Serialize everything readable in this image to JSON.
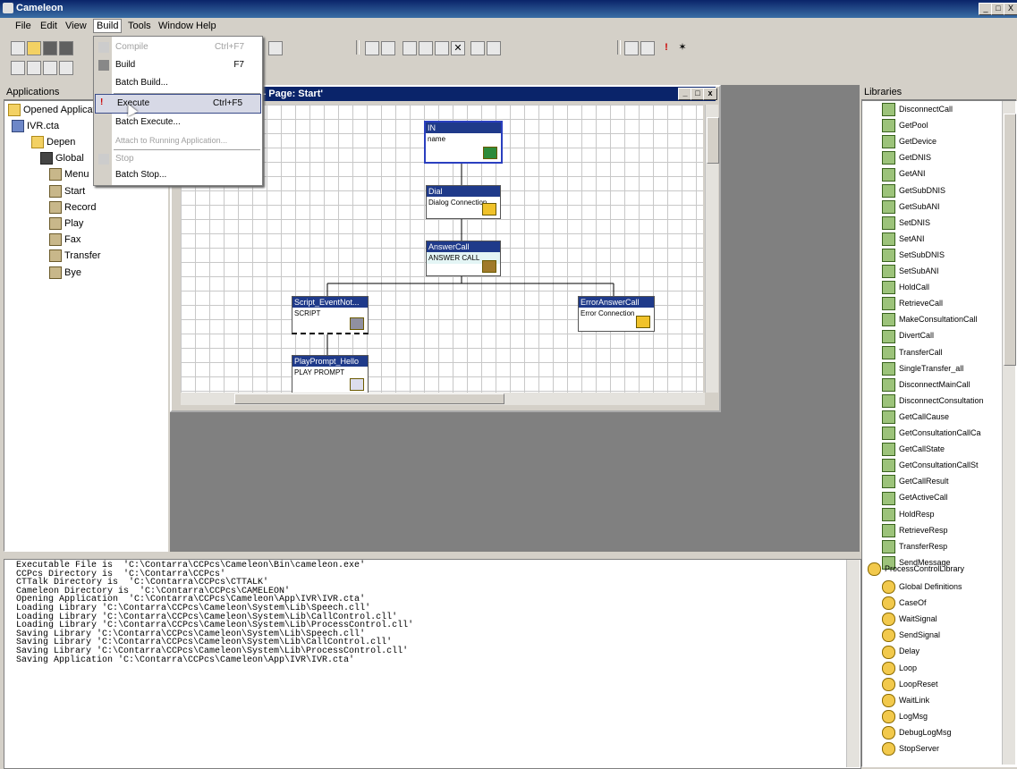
{
  "window": {
    "title": "Cameleon",
    "controls": [
      "_",
      "□",
      "X"
    ]
  },
  "menu": [
    "File",
    "Edit",
    "View",
    "Build",
    "Tools",
    "Window",
    "Help"
  ],
  "build_menu": {
    "items": [
      {
        "label": "Compile",
        "shortcut": "Ctrl+F7",
        "disabled": true
      },
      {
        "label": "Build",
        "shortcut": "F7",
        "disabled": false
      },
      {
        "label": "Batch Build...",
        "shortcut": "",
        "disabled": false
      },
      {
        "label": "Execute",
        "shortcut": "Ctrl+F5",
        "disabled": false,
        "selected": true
      },
      {
        "label": "Batch Execute...",
        "shortcut": "",
        "disabled": false
      },
      {
        "label": "Attach to Running Application...",
        "shortcut": "",
        "disabled": true
      },
      {
        "label": "Stop",
        "shortcut": "",
        "disabled": true
      },
      {
        "label": "Batch Stop...",
        "shortcut": "",
        "disabled": false
      }
    ]
  },
  "applications_panel": {
    "title": "Applications",
    "root": "Opened Applications",
    "app": "IVR.cta",
    "children": [
      "Depen",
      "Global",
      "Menu",
      "Start",
      "Record",
      "Play",
      "Fax",
      "Transfer",
      "Bye"
    ]
  },
  "editor": {
    "title": "cta' - Page: Start'",
    "nodes": [
      {
        "title": "IN",
        "body": "name"
      },
      {
        "title": "Dial",
        "body": "Dialog Connection"
      },
      {
        "title": "AnswerCall",
        "body": "ANSWER CALL"
      },
      {
        "title": "Script_EventNot...",
        "body": "SCRIPT"
      },
      {
        "title": "ErrorAnswerCall",
        "body": "Error Connection"
      },
      {
        "title": "PlayPrompt_Hello",
        "body": "PLAY PROMPT"
      }
    ]
  },
  "output_lines": [
    "Executable File is  'C:\\Contarra\\CCPcs\\Cameleon\\Bin\\cameleon.exe'",
    "CCPcs Directory is  'C:\\Contarra\\CCPcs'",
    "CTTalk Directory is  'C:\\Contarra\\CCPcs\\CTTALK'",
    "Cameleon Directory is  'C:\\Contarra\\CCPcs\\CAMELEON'",
    "Opening Application  'C:\\Contarra\\CCPcs\\Cameleon\\App\\IVR\\IVR.cta'",
    "Loading Library 'C:\\Contarra\\CCPcs\\Cameleon\\System\\Lib\\Speech.cll'",
    "Loading Library 'C:\\Contarra\\CCPcs\\Cameleon\\System\\Lib\\CallControl.cll'",
    "Loading Library 'C:\\Contarra\\CCPcs\\Cameleon\\System\\Lib\\ProcessControl.cll'",
    "Saving Library 'C:\\Contarra\\CCPcs\\Cameleon\\System\\Lib\\Speech.cll'",
    "Saving Library 'C:\\Contarra\\CCPcs\\Cameleon\\System\\Lib\\CallControl.cll'",
    "Saving Library 'C:\\Contarra\\CCPcs\\Cameleon\\System\\Lib\\ProcessControl.cll'",
    "Saving Application 'C:\\Contarra\\CCPcs\\Cameleon\\App\\IVR\\IVR.cta'"
  ],
  "libraries_panel": {
    "title": "Libraries",
    "call_items": [
      "DisconnectCall",
      "GetPool",
      "GetDevice",
      "GetDNIS",
      "GetANI",
      "GetSubDNIS",
      "GetSubANI",
      "SetDNIS",
      "SetANI",
      "SetSubDNIS",
      "SetSubANI",
      "HoldCall",
      "RetrieveCall",
      "MakeConsultationCall",
      "DivertCall",
      "TransferCall",
      "SingleTransfer_all",
      "DisconnectMainCall",
      "DisconnectConsultation",
      "GetCallCause",
      "GetConsultationCallCa",
      "GetCallState",
      "GetConsultationCallSt",
      "GetCallResult",
      "GetActiveCall",
      "HoldResp",
      "RetrieveResp",
      "TransferResp",
      "SendMessage"
    ],
    "process_library": "ProcessControlLibrary",
    "process_items": [
      "Global Definitions",
      "CaseOf",
      "WaitSignal",
      "SendSignal",
      "Delay",
      "Loop",
      "LoopReset",
      "WaitLink",
      "LogMsg",
      "DebugLogMsg",
      "StopServer"
    ]
  }
}
